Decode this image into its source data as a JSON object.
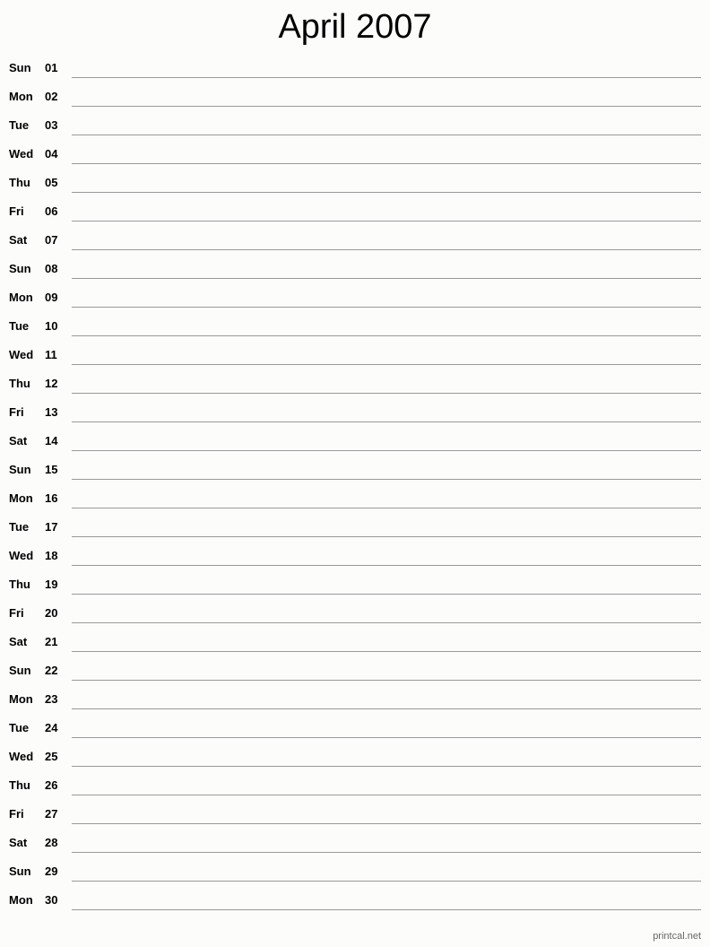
{
  "title": "April 2007",
  "days": [
    {
      "dow": "Sun",
      "day": "01"
    },
    {
      "dow": "Mon",
      "day": "02"
    },
    {
      "dow": "Tue",
      "day": "03"
    },
    {
      "dow": "Wed",
      "day": "04"
    },
    {
      "dow": "Thu",
      "day": "05"
    },
    {
      "dow": "Fri",
      "day": "06"
    },
    {
      "dow": "Sat",
      "day": "07"
    },
    {
      "dow": "Sun",
      "day": "08"
    },
    {
      "dow": "Mon",
      "day": "09"
    },
    {
      "dow": "Tue",
      "day": "10"
    },
    {
      "dow": "Wed",
      "day": "11"
    },
    {
      "dow": "Thu",
      "day": "12"
    },
    {
      "dow": "Fri",
      "day": "13"
    },
    {
      "dow": "Sat",
      "day": "14"
    },
    {
      "dow": "Sun",
      "day": "15"
    },
    {
      "dow": "Mon",
      "day": "16"
    },
    {
      "dow": "Tue",
      "day": "17"
    },
    {
      "dow": "Wed",
      "day": "18"
    },
    {
      "dow": "Thu",
      "day": "19"
    },
    {
      "dow": "Fri",
      "day": "20"
    },
    {
      "dow": "Sat",
      "day": "21"
    },
    {
      "dow": "Sun",
      "day": "22"
    },
    {
      "dow": "Mon",
      "day": "23"
    },
    {
      "dow": "Tue",
      "day": "24"
    },
    {
      "dow": "Wed",
      "day": "25"
    },
    {
      "dow": "Thu",
      "day": "26"
    },
    {
      "dow": "Fri",
      "day": "27"
    },
    {
      "dow": "Sat",
      "day": "28"
    },
    {
      "dow": "Sun",
      "day": "29"
    },
    {
      "dow": "Mon",
      "day": "30"
    }
  ],
  "footer": "printcal.net"
}
